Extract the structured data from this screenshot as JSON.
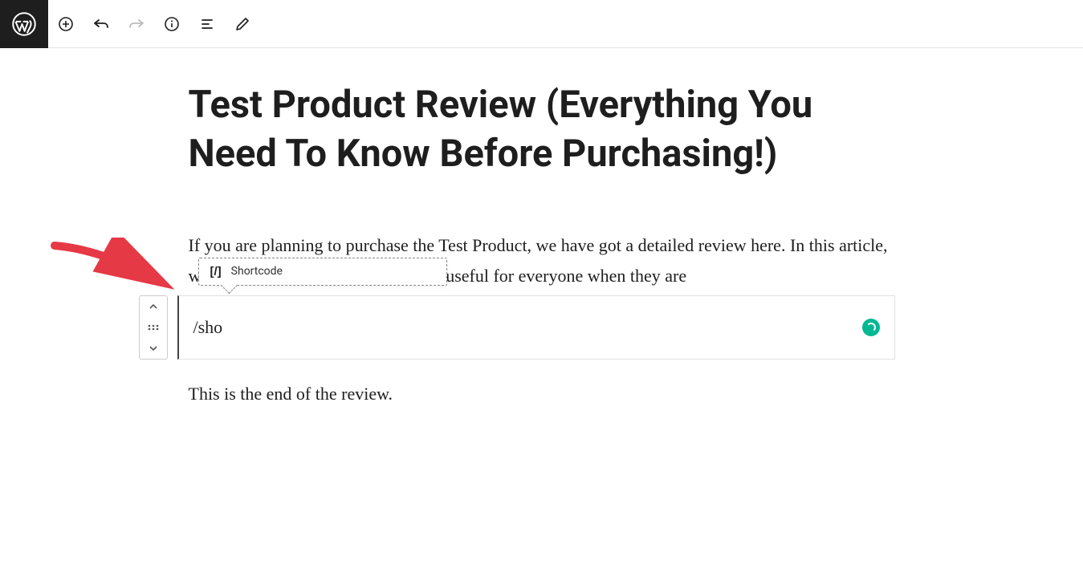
{
  "toolbar": {
    "logo_label": "WordPress",
    "add_label": "Add block",
    "undo_label": "Undo",
    "redo_label": "Redo",
    "info_label": "Content structure",
    "outline_label": "Block navigation",
    "edit_label": "Tools"
  },
  "post": {
    "title": "Test Product Review (Everything You Need To Know Before Purchasing!)",
    "paragraph1": "If you are planning to purchase the Test Product, we have got a detailed review here. In this article, we will be showing you why Test is useful for everyone when they are",
    "paragraph2": "This is the end of the review."
  },
  "block": {
    "input_value": "/sho",
    "suggestion_icon": "[/]",
    "suggestion_label": "Shortcode",
    "mover_up_label": "Move up",
    "mover_down_label": "Move down",
    "drag_label": "Drag"
  }
}
